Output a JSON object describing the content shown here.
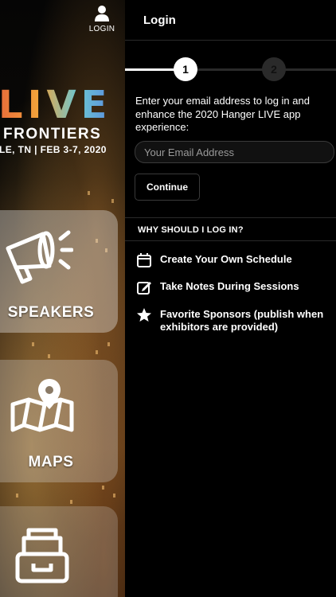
{
  "background": {
    "login_label": "LOGIN",
    "brand_title": "LIVE",
    "brand_subtitle": "FRONTIERS",
    "brand_date": "LE, TN  |  FEB 3-7, 2020",
    "tiles": [
      {
        "label": "SPEAKERS",
        "icon": "megaphone-icon"
      },
      {
        "label": "MAPS",
        "icon": "map-icon"
      },
      {
        "label": "",
        "icon": "file-drawer-icon"
      }
    ]
  },
  "drawer": {
    "title": "Login",
    "steps": [
      "1",
      "2"
    ],
    "instructions": "Enter your email address to log in and enhance the 2020 Hanger LIVE app experience:",
    "email": {
      "placeholder": "Your Email Address",
      "value": ""
    },
    "continue_label": "Continue",
    "why_header": "WHY SHOULD I LOG IN?",
    "benefits": [
      {
        "icon": "calendar-icon",
        "label": "Create Your Own Schedule"
      },
      {
        "icon": "edit-note-icon",
        "label": "Take Notes During Sessions"
      },
      {
        "icon": "star-icon",
        "label": "Favorite Sponsors (publish when exhibitors are provided)"
      }
    ]
  },
  "colors": {
    "background": "#000000",
    "accent_orange": "#e96c3a",
    "accent_blue": "#5a8fe0",
    "separator": "#2a2a2a"
  }
}
